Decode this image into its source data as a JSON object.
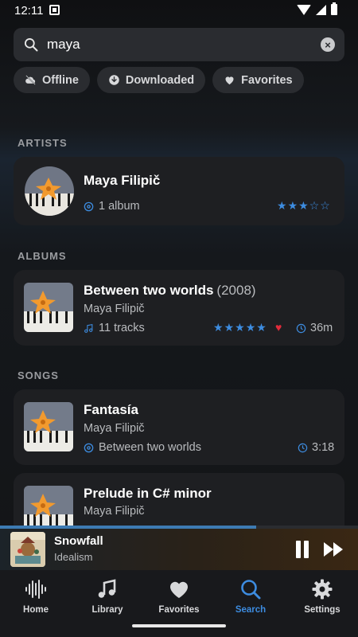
{
  "status": {
    "time": "12:11"
  },
  "search": {
    "query": "maya"
  },
  "chips": [
    {
      "label": "Offline",
      "icon": "cloud-off-icon"
    },
    {
      "label": "Downloaded",
      "icon": "download-icon"
    },
    {
      "label": "Favorites",
      "icon": "heart-icon"
    }
  ],
  "sections": {
    "artists": "ARTISTS",
    "albums": "ALBUMS",
    "songs": "SONGS"
  },
  "artist": {
    "name": "Maya Filipič",
    "albums": "1 album",
    "rating": 3
  },
  "album": {
    "title": "Between two worlds",
    "year": "(2008)",
    "artist": "Maya Filipič",
    "tracks": "11 tracks",
    "rating": 5,
    "favorite": true,
    "duration": "36m"
  },
  "songs": [
    {
      "title": "Fantasía",
      "artist": "Maya Filipič",
      "album": "Between two worlds",
      "duration": "3:18"
    },
    {
      "title": "Prelude in C# minor",
      "artist": "Maya Filipič",
      "album": "",
      "duration": ""
    }
  ],
  "now_playing": {
    "title": "Snowfall",
    "artist": "Idealism",
    "progress": 0.715
  },
  "nav": {
    "items": [
      {
        "label": "Home",
        "icon": "waveform-icon"
      },
      {
        "label": "Library",
        "icon": "music-note-icon"
      },
      {
        "label": "Favorites",
        "icon": "heart-icon"
      },
      {
        "label": "Search",
        "icon": "search-icon"
      },
      {
        "label": "Settings",
        "icon": "gear-icon"
      }
    ],
    "active": "Search"
  },
  "colors": {
    "accent": "#3d8ce0",
    "favorite": "#e22b3b",
    "progress": "#3d7bb3"
  }
}
